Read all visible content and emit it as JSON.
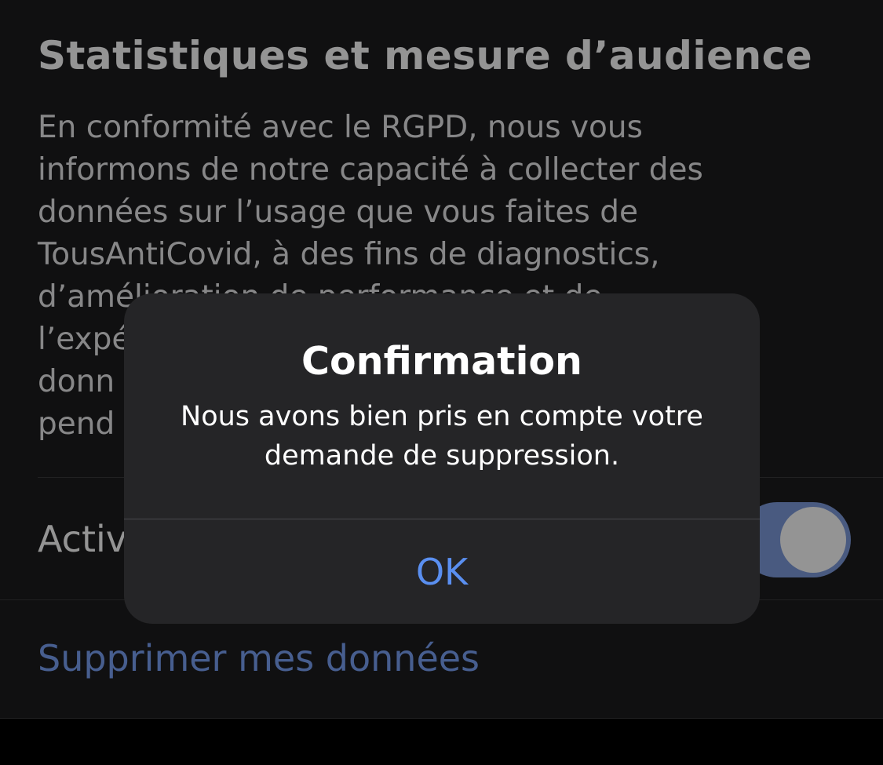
{
  "settings": {
    "section_title": "Statistiques et mesure d’audience",
    "description_lines": [
      "En conformité avec le RGPD, nous vous",
      "informons de notre capacité à collecter des",
      "données sur l’usage que vous faites de",
      "TousAntiCovid, à des fins de diagnostics,",
      "d’amélioration de performance et de",
      "l’expé",
      "donn",
      "pend"
    ],
    "toggle_label": "Activ",
    "toggle_on": true,
    "delete_link": "Supprimer mes données"
  },
  "alert": {
    "title": "Confirmation",
    "body": "Nous avons bien pris en compte votre demande de suppression.",
    "ok_label": "OK"
  },
  "colors": {
    "accent_link": "#7aa2f7",
    "alert_button": "#5a8ff0",
    "toggle_on": "#7e9bdc",
    "background": "#1c1c1e",
    "alert_background": "#252527"
  }
}
